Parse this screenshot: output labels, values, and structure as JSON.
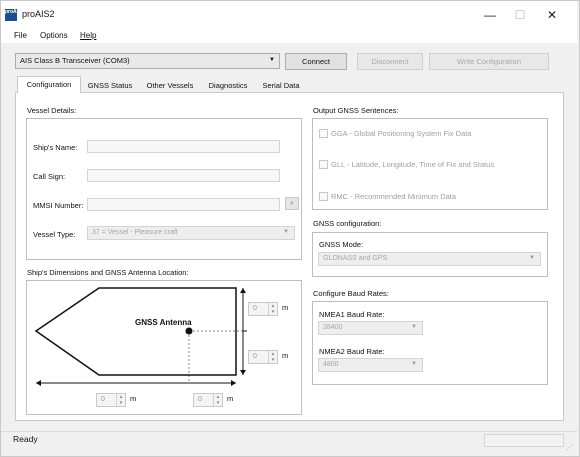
{
  "window": {
    "title": "proAIS2",
    "icon_text": "proAIS",
    "controls": {
      "minimize": "—",
      "maximize": "☐",
      "close": "✕"
    }
  },
  "menu": [
    {
      "label": "File"
    },
    {
      "label": "Options"
    },
    {
      "label": "Help"
    }
  ],
  "toolbar": {
    "device": "AIS Class B Transceiver (COM3)",
    "connect_label": "Connect",
    "disconnect_label": "Disconnect",
    "write_config_label": "Write Configuration"
  },
  "tabs": [
    {
      "label": "Configuration",
      "active": true
    },
    {
      "label": "GNSS Status"
    },
    {
      "label": "Other Vessels"
    },
    {
      "label": "Diagnostics"
    },
    {
      "label": "Serial Data"
    }
  ],
  "vessel": {
    "section_title": "Vessel Details:",
    "ships_name_label": "Ship's Name:",
    "ships_name_value": "",
    "call_sign_label": "Call Sign:",
    "call_sign_value": "",
    "mmsi_label": "MMSI Number:",
    "mmsi_value": "",
    "vessel_type_label": "Vessel Type:",
    "vessel_type_value": "37 = Vessel - Pleasure craft"
  },
  "dimensions": {
    "section_title": "Ship's Dimensions and GNSS Antenna Location:",
    "antenna_label": "GNSS Antenna",
    "unit": "m",
    "top_right_value": "0",
    "middle_right_value": "0",
    "bottom_left_value": "0",
    "bottom_right_value": "0"
  },
  "output": {
    "section_title": "Output GNSS Sentences:",
    "gga_label": "GGA - Global Positioning System Fix Data",
    "gll_label": "GLL - Latitude, Longitude, Time of Fix and Status",
    "rmc_label": "RMC - Recommended Minimum Data"
  },
  "gnss_config": {
    "section_title": "GNSS configuration:",
    "mode_label": "GNSS Mode:",
    "mode_value": "GLONASS and GPS"
  },
  "baud": {
    "section_title": "Configure Baud Rates:",
    "nmea1_label": "NMEA1 Baud Rate:",
    "nmea1_value": "38400",
    "nmea2_label": "NMEA2 Baud Rate:",
    "nmea2_value": "4800"
  },
  "status": {
    "text": "Ready"
  },
  "colors": {
    "window_bg": "#f0f0f0",
    "panel_bg": "#ffffff",
    "disabled_text": "#a8a8a8",
    "accent": "#1f4e8c"
  }
}
